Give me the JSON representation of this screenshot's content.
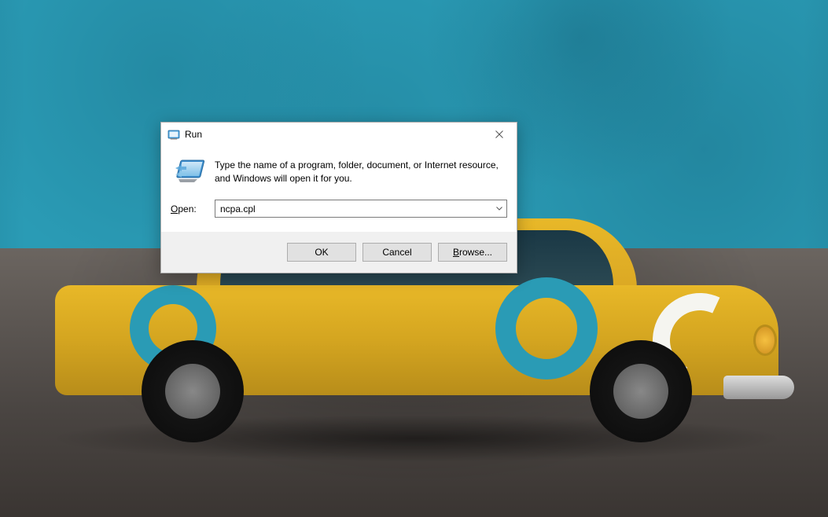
{
  "dialog": {
    "title": "Run",
    "description": "Type the name of a program, folder, document, or Internet resource, and Windows will open it for you.",
    "open_label_prefix": "O",
    "open_label_rest": "pen:",
    "input_value": "ncpa.cpl",
    "buttons": {
      "ok": "OK",
      "cancel": "Cancel",
      "browse_prefix": "B",
      "browse_rest": "rowse..."
    }
  }
}
